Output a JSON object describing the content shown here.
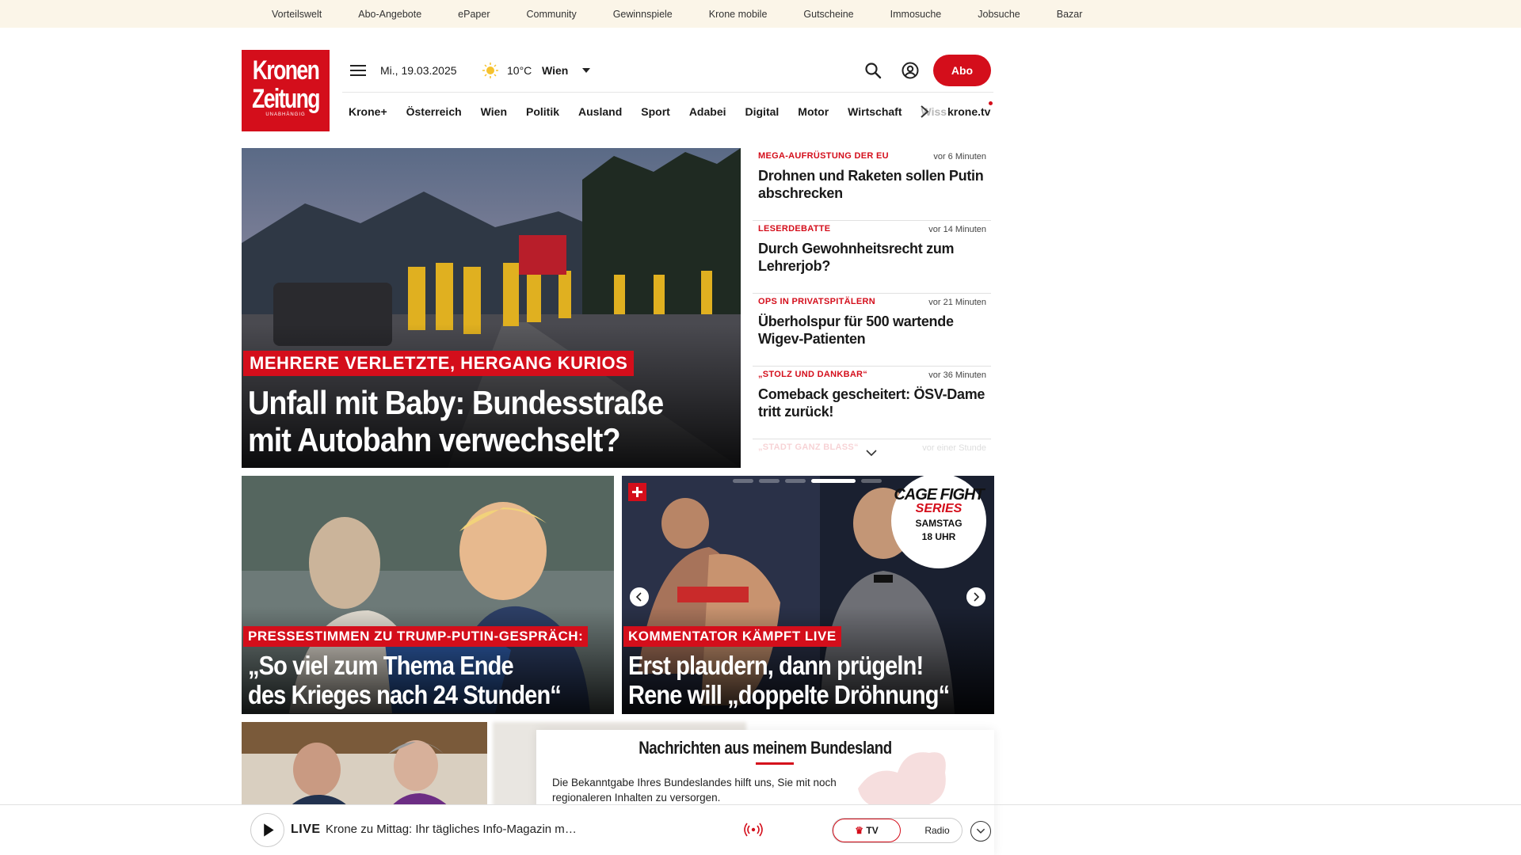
{
  "topbar": {
    "links": [
      "Vorteilswelt",
      "Abo-Angebote",
      "ePaper",
      "Community",
      "Gewinnspiele",
      "Krone mobile",
      "Gutscheine",
      "Immosuche",
      "Jobsuche",
      "Bazar"
    ]
  },
  "logo": {
    "line1": "Kronen",
    "line2": "Zeitung",
    "tagline": "UNABHÄNGIG"
  },
  "header": {
    "date": "Mi., 19.03.2025",
    "temperature": "10°C",
    "city": "Wien",
    "abo_label": "Abo"
  },
  "nav": {
    "items": [
      "Krone+",
      "Österreich",
      "Wien",
      "Politik",
      "Ausland",
      "Sport",
      "Adabei",
      "Digital",
      "Motor",
      "Wirtschaft"
    ],
    "truncated": "Wiss",
    "kronetv": "krone.tv"
  },
  "hero": {
    "kicker": "MEHRERE VERLETZTE, HERGANG KURIOS",
    "headline_line1": "Unfall mit Baby: Bundesstraße",
    "headline_line2": "mit Autobahn verwechselt?"
  },
  "sidebar": {
    "items": [
      {
        "kicker": "MEGA-AUFRÜSTUNG DER EU",
        "time": "vor 6 Minuten",
        "title": "Drohnen und Raketen sollen Putin abschrecken"
      },
      {
        "kicker": "LESERDEBATTE",
        "time": "vor 14 Minuten",
        "title": "Durch Gewohnheitsrecht zum Lehrerjob?"
      },
      {
        "kicker": "OPS IN PRIVATSPITÄLERN",
        "time": "vor 21 Minuten",
        "title": "Überholspur für 500 wartende Wigev-Patienten"
      },
      {
        "kicker": "„STOLZ UND DANKBAR“",
        "time": "vor 36 Minuten",
        "title": "Comeback gescheitert: ÖSV-Dame tritt zurück!"
      },
      {
        "kicker": "„STADT GANZ BLASS“",
        "time": "vor einer Stunde",
        "title": ""
      }
    ]
  },
  "teaser1": {
    "kicker": "PRESSESTIMMEN ZU TRUMP-PUTIN-GESPRÄCH:",
    "headline_line1": "„So viel zum Thema Ende",
    "headline_line2": "des Krieges nach 24 Stunden“"
  },
  "teaser2": {
    "kicker": "KOMMENTATOR KÄMPFT LIVE",
    "headline_line1": "Erst plaudern, dann prügeln!",
    "headline_line2": "Rene will „doppelte Dröhnung“",
    "badge_line1": "CAGE FIGHT",
    "badge_line2": "SERIES",
    "badge_line3": "SAMSTAG",
    "badge_line4": "18 UHR"
  },
  "region": {
    "title": "Nachrichten aus meinem Bundesland",
    "description": "Die Bekanntgabe Ihres Bundeslandes hilft uns, Sie mit noch regionaleren Inhalten zu versorgen."
  },
  "player": {
    "live_label": "LIVE",
    "title": "Krone zu Mittag: Ihr tägliches Info-Magazin mit allen brandheißen Them...",
    "tv_label": "TV",
    "radio_label": "Radio"
  },
  "colors": {
    "brand": "#d40e1b",
    "topbar_bg": "#fbf5e8"
  }
}
